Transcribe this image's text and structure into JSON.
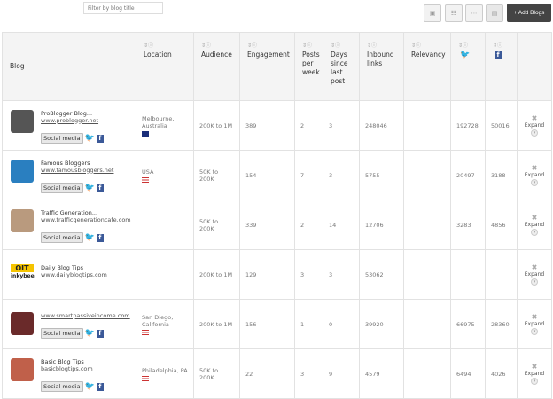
{
  "toolbar": {
    "filter_placeholder": "Filter by blog title",
    "add_label": "+ Add Blogs",
    "view_icons": [
      "grid-large-icon",
      "list-icon",
      "grid-small-icon",
      "table-view-icon"
    ]
  },
  "columns": [
    "Blog",
    "Location",
    "Audience",
    "Engagement",
    "Posts per week",
    "Days since last post",
    "Inbound links",
    "Relevancy",
    "twitter-icon",
    "facebook-icon"
  ],
  "rows": [
    {
      "title": "ProBlogger Blog...",
      "url": "www.problogger.net",
      "tag": "Social media",
      "social": true,
      "location": "Melbourne, Australia",
      "flag": "australia",
      "audience": "200K to 1M",
      "engagement": "389",
      "posts": "2",
      "days": "3",
      "inbound": "248046",
      "relevancy": "",
      "twitter": "192728",
      "facebook": "50016",
      "avatar": "#555"
    },
    {
      "title": "Famous Bloggers",
      "url": "www.famousbloggers.net",
      "tag": "Social media",
      "social": true,
      "location": "USA",
      "flag": "usa",
      "audience": "50K to 200K",
      "engagement": "154",
      "posts": "7",
      "days": "3",
      "inbound": "5755",
      "relevancy": "",
      "twitter": "20497",
      "facebook": "3188",
      "avatar": "#2a7fc0"
    },
    {
      "title": "Traffic Generation...",
      "url": "www.trafficgenerationcafe.com",
      "tag": "Social media",
      "social": true,
      "location": "",
      "flag": "",
      "audience": "50K to 200K",
      "engagement": "339",
      "posts": "2",
      "days": "14",
      "inbound": "12706",
      "relevancy": "",
      "twitter": "3283",
      "facebook": "4856",
      "avatar": "#b99a7e"
    },
    {
      "title": "Daily Blog Tips",
      "url": "www.dailyblogtips.com",
      "tag": "",
      "social": false,
      "location": "",
      "flag": "",
      "audience": "200K to 1M",
      "engagement": "129",
      "posts": "3",
      "days": "3",
      "inbound": "53062",
      "relevancy": "",
      "twitter": "",
      "facebook": "",
      "avatar": "inkybee",
      "logo_text": "inkybee"
    },
    {
      "title": "",
      "url": "www.smartpassiveincome.com",
      "tag": "Social media",
      "social": true,
      "location": "San Diego, California",
      "flag": "usa",
      "audience": "200K to 1M",
      "engagement": "156",
      "posts": "1",
      "days": "0",
      "inbound": "39920",
      "relevancy": "",
      "twitter": "66975",
      "facebook": "28360",
      "avatar": "#6a2a2a"
    },
    {
      "title": "Basic Blog Tips",
      "url": "basicblogtips.com",
      "tag": "Social media",
      "social": true,
      "location": "Philadelphia, PA",
      "flag": "usa",
      "audience": "50K to 200K",
      "engagement": "22",
      "posts": "3",
      "days": "9",
      "inbound": "4579",
      "relevancy": "",
      "twitter": "6494",
      "facebook": "4026",
      "avatar": "#c0604a"
    }
  ],
  "actions": {
    "remove": "✖",
    "expand": "Expand"
  }
}
